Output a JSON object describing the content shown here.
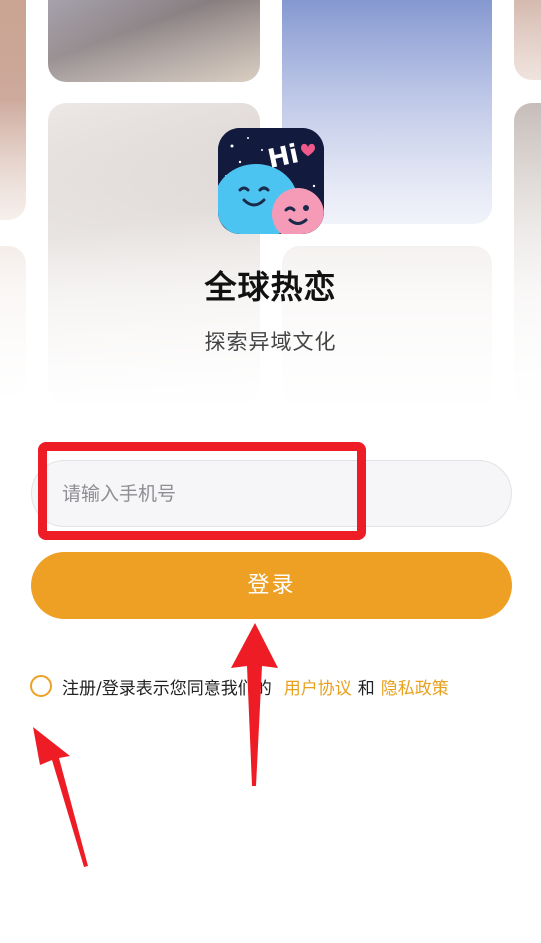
{
  "app": {
    "name": "全球热恋",
    "tagline": "探索异域文化",
    "logo_text": "Hi"
  },
  "login": {
    "phone_placeholder": "请输入手机号",
    "phone_value": "",
    "button_label": "登录"
  },
  "agreement": {
    "prefix": "注册/登录表示您同意我们的",
    "user_agreement": "用户协议",
    "and": "和",
    "privacy_policy": "隐私政策",
    "checked": false
  },
  "colors": {
    "accent": "#eea024",
    "link": "#e8a11f",
    "annotation": "#ee1c25",
    "logo_blue": "#4cc4f2",
    "logo_pink": "#f59bb7",
    "logo_bg": "#121a3d"
  },
  "icons": {
    "app_logo": "app-logo-icon",
    "heart": "heart-icon",
    "checkbox": "checkbox-circle-icon"
  }
}
